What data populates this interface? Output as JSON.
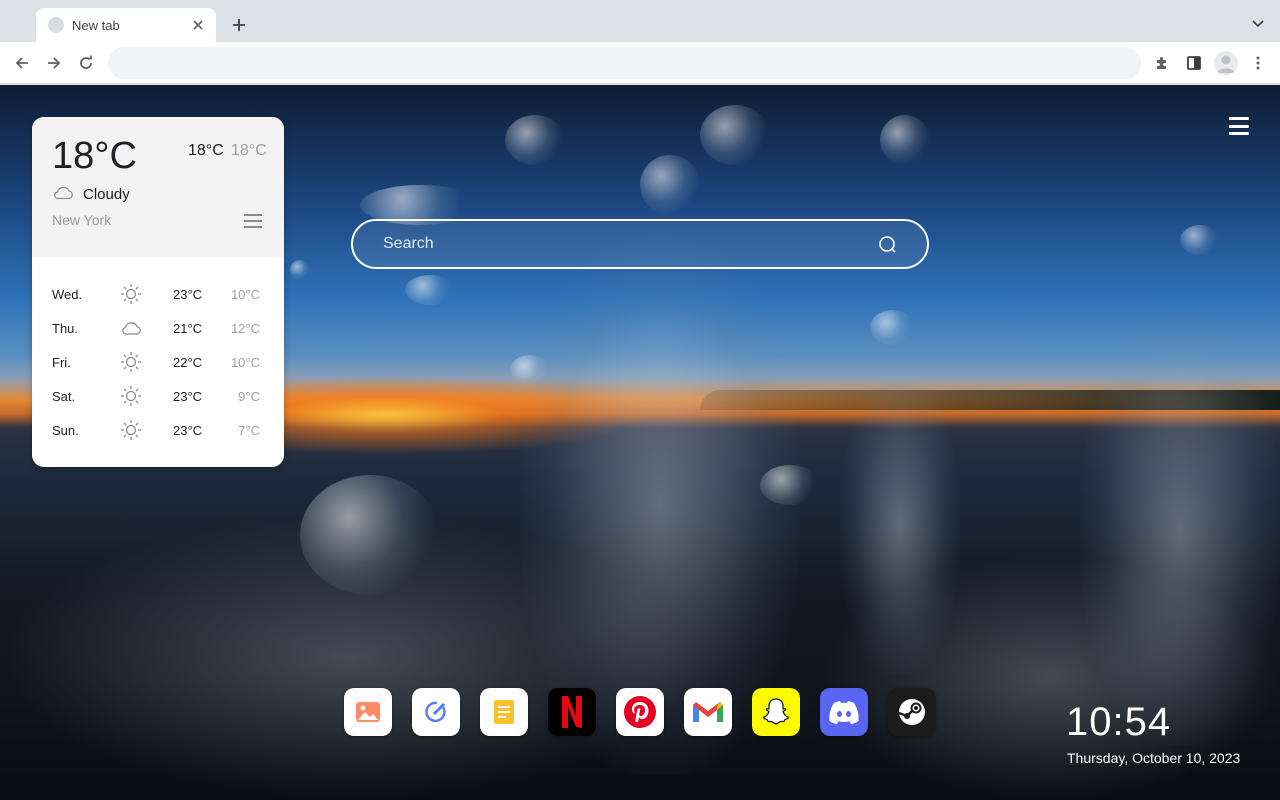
{
  "browser": {
    "tab_title": "New tab",
    "address_value": "",
    "colors": {
      "tabstrip": "#dee1e6",
      "toolbar": "#ffffff",
      "omnibox": "#f1f3f4"
    },
    "icons": [
      "tab-favicon-icon",
      "close-icon",
      "plus-icon",
      "chevron-down-icon",
      "arrow-left-icon",
      "arrow-right-icon",
      "reload-icon",
      "puzzle-icon",
      "side-panel-icon",
      "profile-icon",
      "more-vert-icon"
    ]
  },
  "weather": {
    "current_temp": "18°C",
    "high": "18°C",
    "low": "18°C",
    "condition": "Cloudy",
    "condition_icon": "cloud-icon",
    "city": "New York",
    "forecast": [
      {
        "day": "Wed.",
        "icon": "sun-icon",
        "high": "23°C",
        "low": "10°C"
      },
      {
        "day": "Thu.",
        "icon": "cloud-icon",
        "high": "21°C",
        "low": "12°C"
      },
      {
        "day": "Fri.",
        "icon": "sun-icon",
        "high": "22°C",
        "low": "10°C"
      },
      {
        "day": "Sat.",
        "icon": "sun-icon",
        "high": "23°C",
        "low": "9°C"
      },
      {
        "day": "Sun.",
        "icon": "sun-icon",
        "high": "23°C",
        "low": "7°C"
      }
    ]
  },
  "search": {
    "placeholder": "Search",
    "value": ""
  },
  "dock": {
    "apps": [
      {
        "icon": "photos-icon",
        "bg": "#ffffff"
      },
      {
        "icon": "edit-check-icon",
        "bg": "#ffffff"
      },
      {
        "icon": "notes-icon",
        "bg": "#ffffff"
      },
      {
        "icon": "netflix-icon",
        "bg": "#000000"
      },
      {
        "icon": "pinterest-icon",
        "bg": "#ffffff"
      },
      {
        "icon": "gmail-icon",
        "bg": "#ffffff"
      },
      {
        "icon": "snapchat-icon",
        "bg": "#fffc00"
      },
      {
        "icon": "discord-icon",
        "bg": "#5865f2"
      },
      {
        "icon": "steam-icon",
        "bg": "#1b1b1b"
      }
    ]
  },
  "clock": {
    "time": "10:54",
    "date": "Thursday, October 10, 2023"
  }
}
